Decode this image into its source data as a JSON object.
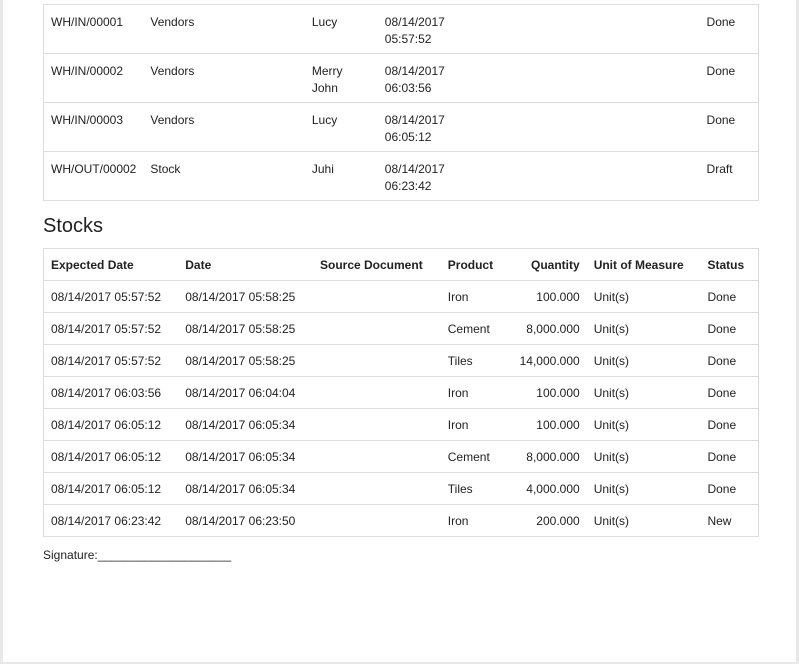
{
  "pickings": [
    {
      "ref": "WH/IN/00001",
      "partner": "Vendors",
      "user": "Lucy",
      "date": "08/14/2017",
      "time": "05:57:52",
      "state": "Done"
    },
    {
      "ref": "WH/IN/00002",
      "partner": "Vendors",
      "user": "Merry John",
      "date": "08/14/2017",
      "time": "06:03:56",
      "state": "Done"
    },
    {
      "ref": "WH/IN/00003",
      "partner": "Vendors",
      "user": "Lucy",
      "date": "08/14/2017",
      "time": "06:05:12",
      "state": "Done"
    },
    {
      "ref": "WH/OUT/00002",
      "partner": "Stock",
      "user": "Juhi",
      "date": "08/14/2017",
      "time": "06:23:42",
      "state": "Draft"
    }
  ],
  "stocks": {
    "title": "Stocks",
    "headers": {
      "expected_date": "Expected Date",
      "date": "Date",
      "source_document": "Source Document",
      "product": "Product",
      "quantity": "Quantity",
      "uom": "Unit of Measure",
      "status": "Status"
    },
    "rows": [
      {
        "expected": "08/14/2017 05:57:52",
        "date": "08/14/2017 05:58:25",
        "source": "",
        "product": "Iron",
        "qty": "100.000",
        "uom": "Unit(s)",
        "status": "Done"
      },
      {
        "expected": "08/14/2017 05:57:52",
        "date": "08/14/2017 05:58:25",
        "source": "",
        "product": "Cement",
        "qty": "8,000.000",
        "uom": "Unit(s)",
        "status": "Done"
      },
      {
        "expected": "08/14/2017 05:57:52",
        "date": "08/14/2017 05:58:25",
        "source": "",
        "product": "Tiles",
        "qty": "14,000.000",
        "uom": "Unit(s)",
        "status": "Done"
      },
      {
        "expected": "08/14/2017 06:03:56",
        "date": "08/14/2017 06:04:04",
        "source": "",
        "product": "Iron",
        "qty": "100.000",
        "uom": "Unit(s)",
        "status": "Done"
      },
      {
        "expected": "08/14/2017 06:05:12",
        "date": "08/14/2017 06:05:34",
        "source": "",
        "product": "Iron",
        "qty": "100.000",
        "uom": "Unit(s)",
        "status": "Done"
      },
      {
        "expected": "08/14/2017 06:05:12",
        "date": "08/14/2017 06:05:34",
        "source": "",
        "product": "Cement",
        "qty": "8,000.000",
        "uom": "Unit(s)",
        "status": "Done"
      },
      {
        "expected": "08/14/2017 06:05:12",
        "date": "08/14/2017 06:05:34",
        "source": "",
        "product": "Tiles",
        "qty": "4,000.000",
        "uom": "Unit(s)",
        "status": "Done"
      },
      {
        "expected": "08/14/2017 06:23:42",
        "date": "08/14/2017 06:23:50",
        "source": "",
        "product": "Iron",
        "qty": "200.000",
        "uom": "Unit(s)",
        "status": "New"
      }
    ]
  },
  "signature": "Signature:____________________"
}
